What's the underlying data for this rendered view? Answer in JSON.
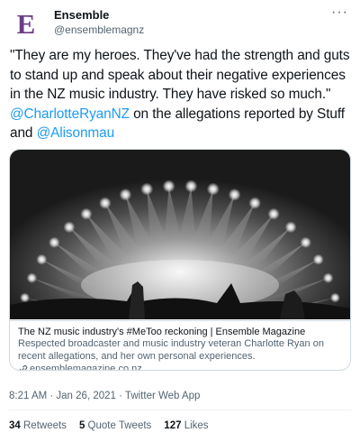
{
  "author": {
    "avatar_letter": "E",
    "display_name": "Ensemble",
    "handle": "@ensemblemagnz"
  },
  "menu_glyph": "···",
  "tweet": {
    "text_part1": "\"They are my heroes. They've had the strength and guts to stand up and speak about their negative experiences in the NZ music industry. They have risked so much.\" ",
    "mention1": "@CharlotteRyanNZ",
    "text_part2": " on the allegations reported by Stuff and ",
    "mention2": "@Alisonmau"
  },
  "card": {
    "image_icon": "concert-stage-lights-photo",
    "title": "The NZ music industry's #MeToo reckoning | Ensemble Magazine",
    "description": "Respected broadcaster and music industry veteran Charlotte Ryan on recent allegations, and her own personal experiences.",
    "domain": "ensemblemagazine.co.nz"
  },
  "meta": {
    "timestamp": "8:21 AM · Jan 26, 2021 · Twitter Web App"
  },
  "stats": {
    "retweets_count": "34",
    "retweets_label": "Retweets",
    "quote_count": "5",
    "quote_label": "Quote Tweets",
    "likes_count": "127",
    "likes_label": "Likes"
  },
  "colors": {
    "link": "#1d9bf0",
    "secondary_text": "#536471",
    "avatar_letter": "#6a3d86"
  }
}
